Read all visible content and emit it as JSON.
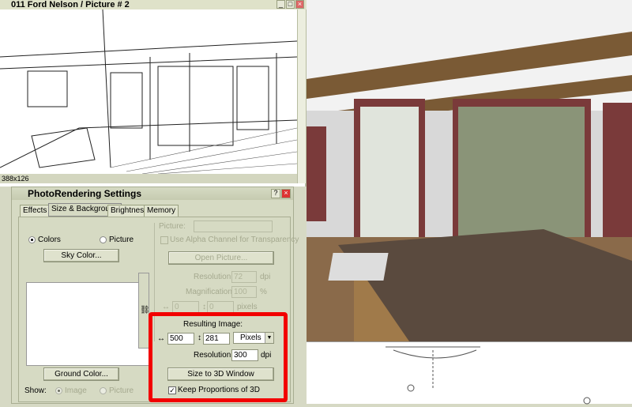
{
  "picture_window": {
    "title": "011 Ford Nelson / Picture # 2",
    "size_label": "388x126"
  },
  "dialog": {
    "title": "PhotoRendering Settings",
    "tabs": [
      {
        "label": "Effects"
      },
      {
        "label": "Size & Background"
      },
      {
        "label": "Brightness"
      },
      {
        "label": "Memory"
      }
    ],
    "active_tab": "Size & Background",
    "background": {
      "colors_label": "Colors",
      "picture_label": "Picture",
      "selected": "Colors",
      "sky_color_button": "Sky Color...",
      "ground_color_button": "Ground Color...",
      "show_label": "Show:",
      "show_image": "Image",
      "show_picture": "Picture"
    },
    "picture_section": {
      "picture_label": "Picture:",
      "alpha_label": "Use Alpha Channel for Transparency",
      "open_button": "Open Picture...",
      "resolution_label": "Resolution:",
      "resolution_value": "72",
      "resolution_unit": "dpi",
      "magnification_label": "Magnification:",
      "magnification_value": "100",
      "magnification_unit": "%",
      "width_value": "0",
      "height_value": "0",
      "size_unit": "pixels"
    },
    "resulting": {
      "heading": "Resulting Image:",
      "width": "500",
      "height": "281",
      "unit": "Pixels",
      "resolution_label": "Resolution:",
      "resolution": "300",
      "resolution_unit": "dpi",
      "size_button": "Size to 3D Window",
      "keep_label": "Keep Proportions of 3D",
      "keep_checked": true
    }
  },
  "colors": {
    "highlight": "#f20000",
    "dialog_bg": "#d6dac3"
  }
}
